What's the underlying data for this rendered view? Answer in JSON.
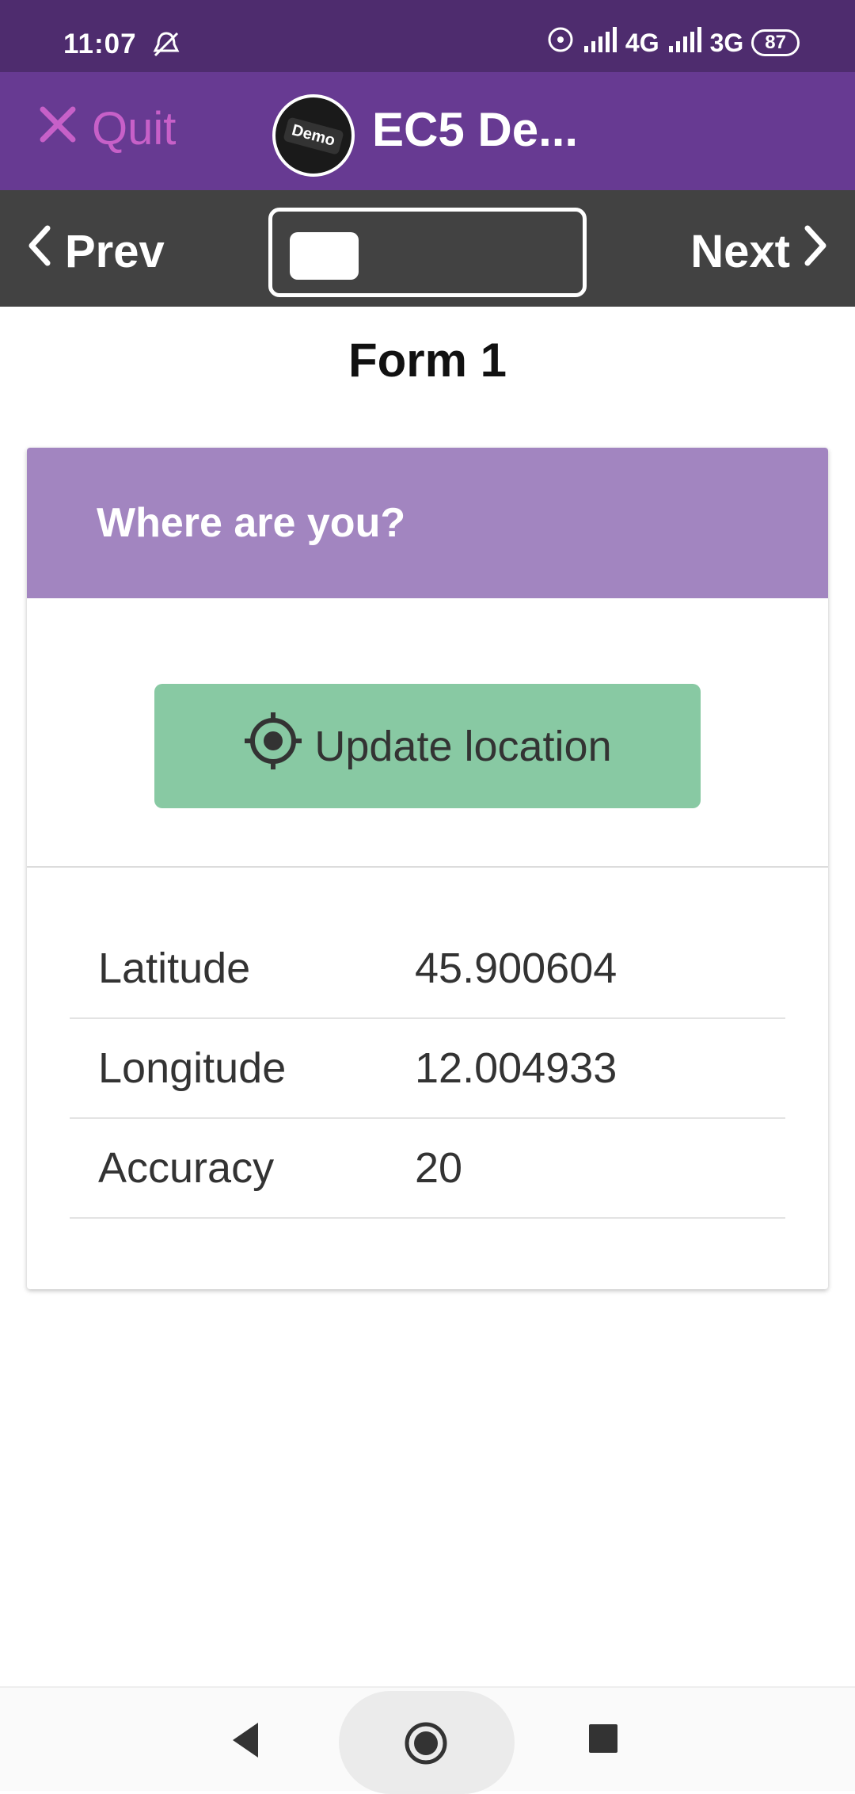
{
  "status_bar": {
    "time": "11:07",
    "network_1": "4G",
    "network_2": "3G",
    "battery": "87"
  },
  "header": {
    "quit_label": "Quit",
    "logo_text": "Demo",
    "project_title": "EC5 De...",
    "colors": {
      "background": "#673a92",
      "quit": "#c760c8"
    }
  },
  "nav": {
    "prev_label": "Prev",
    "next_label": "Next",
    "progress": 0.25
  },
  "form": {
    "title": "Form 1",
    "question": "Where are you?",
    "update_button_label": "Update location",
    "location": [
      {
        "label": "Latitude",
        "value": "45.900604"
      },
      {
        "label": "Longitude",
        "value": "12.004933"
      },
      {
        "label": "Accuracy",
        "value": "20"
      }
    ]
  }
}
